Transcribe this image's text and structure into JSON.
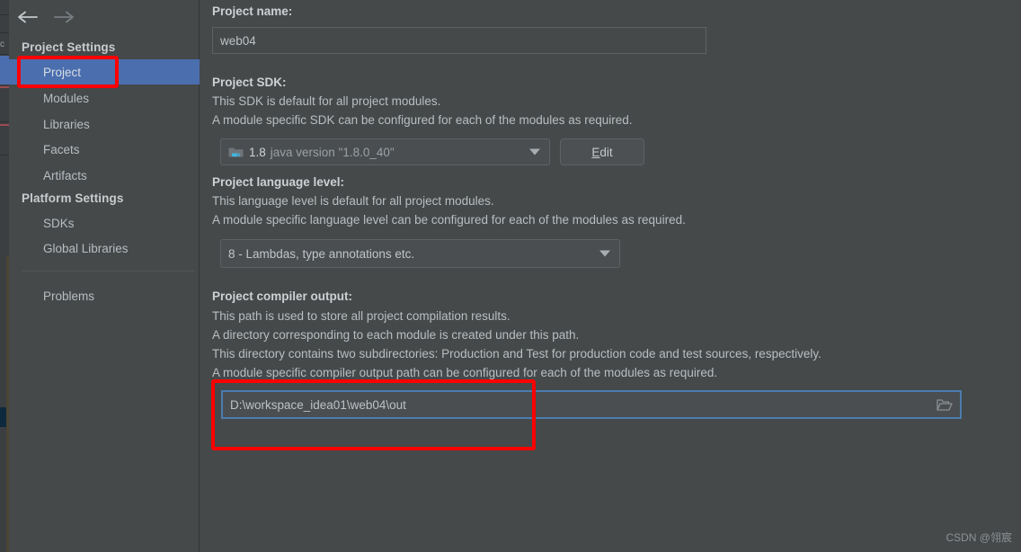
{
  "window": {
    "nav_back": "back-arrow",
    "nav_forward": "forward-arrow"
  },
  "sidebar": {
    "groups": [
      {
        "title": "Project Settings"
      },
      {
        "title": "Platform Settings"
      }
    ],
    "project_settings_items": [
      {
        "label": "Project",
        "selected": true
      },
      {
        "label": "Modules",
        "selected": false
      },
      {
        "label": "Libraries",
        "selected": false
      },
      {
        "label": "Facets",
        "selected": false
      },
      {
        "label": "Artifacts",
        "selected": false
      }
    ],
    "platform_settings_items": [
      {
        "label": "SDKs",
        "selected": false
      },
      {
        "label": "Global Libraries",
        "selected": false
      }
    ],
    "other_items": [
      {
        "label": "Problems",
        "selected": false
      }
    ]
  },
  "main": {
    "project_name": {
      "label": "Project name:",
      "value": "web04"
    },
    "project_sdk": {
      "label": "Project SDK:",
      "desc_line1": "This SDK is default for all project modules.",
      "desc_line2": "A module specific SDK can be configured for each of the modules as required.",
      "selected_version": "1.8",
      "selected_detail": "java version \"1.8.0_40\"",
      "edit_button_mnemonic": "E",
      "edit_button_rest": "dit"
    },
    "project_language_level": {
      "label": "Project language level:",
      "desc_line1": "This language level is default for all project modules.",
      "desc_line2": "A module specific language level can be configured for each of the modules as required.",
      "selected": "8 - Lambdas, type annotations etc."
    },
    "project_compiler_output": {
      "label": "Project compiler output:",
      "desc_line1": "This path is used to store all project compilation results.",
      "desc_line2": "A directory corresponding to each module is created under this path.",
      "desc_line3": "This directory contains two subdirectories: Production and Test for production code and test sources, respectively.",
      "desc_line4": "A module specific compiler output path can be configured for each of the modules as required.",
      "value": "D:\\workspace_idea01\\web04\\out",
      "browse_icon": "folder-icon"
    }
  },
  "annotations": {
    "color": "#fe0000",
    "project_item_box": "highlight-project-sidebar-item",
    "compiler_output_box": "highlight-compiler-output-path"
  },
  "watermark": {
    "text": "CSDN @翎宸"
  },
  "edge": {
    "partial_letter": "c"
  }
}
